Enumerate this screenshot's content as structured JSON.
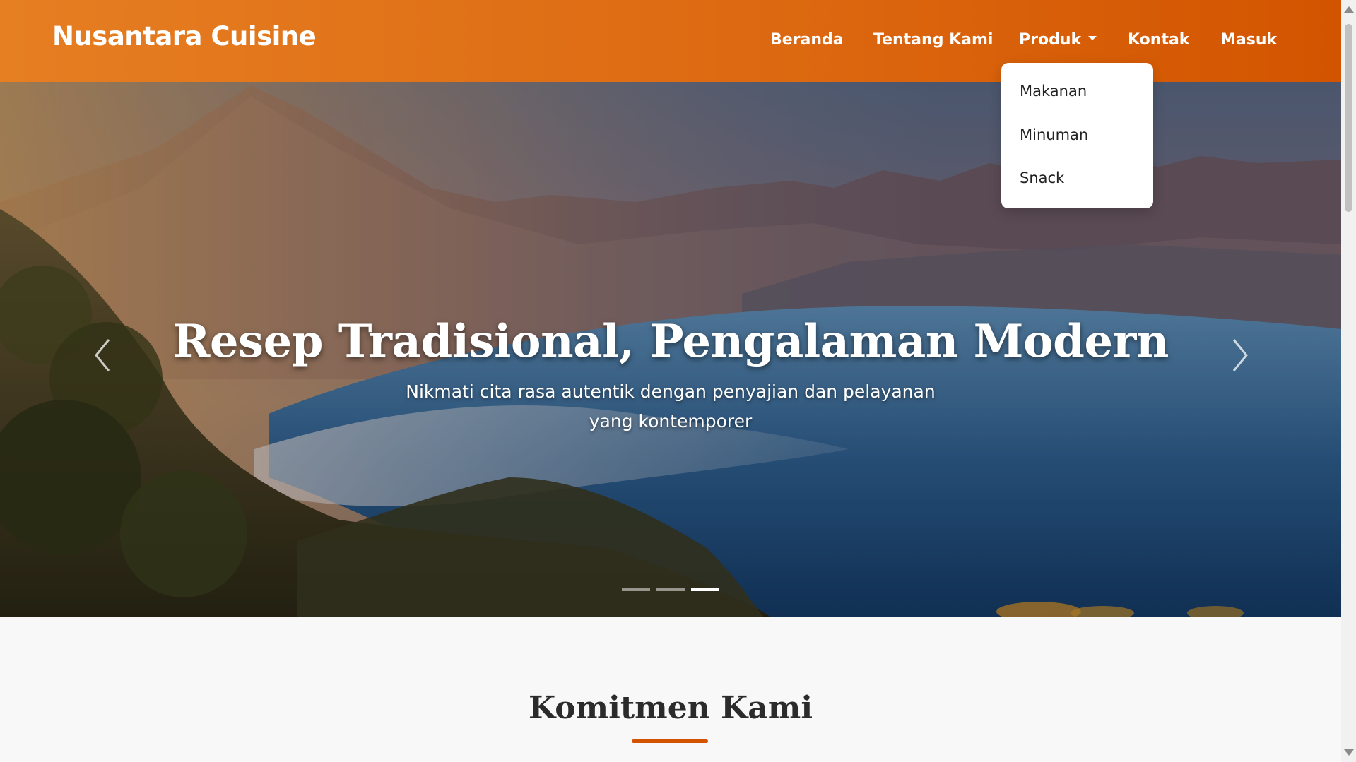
{
  "navbar": {
    "brand": "Nusantara Cuisine",
    "links": [
      "Beranda",
      "Tentang Kami",
      "Produk",
      "Kontak",
      "Masuk"
    ],
    "accent_color": "#e67e22"
  },
  "dropdown": {
    "items": [
      "Makanan",
      "Minuman",
      "Snack"
    ]
  },
  "hero": {
    "title": "Resep Tradisional, Pengalaman Modern",
    "subtitle": "Nikmati cita rasa autentik dengan penyajian dan pelayanan yang kontemporer",
    "prev_icon": "chevron-left-icon",
    "next_icon": "chevron-right-icon",
    "slides_total": 3,
    "active_slide": 3
  },
  "section": {
    "title": "Komitmen Kami",
    "underline_color": "#d35400"
  }
}
